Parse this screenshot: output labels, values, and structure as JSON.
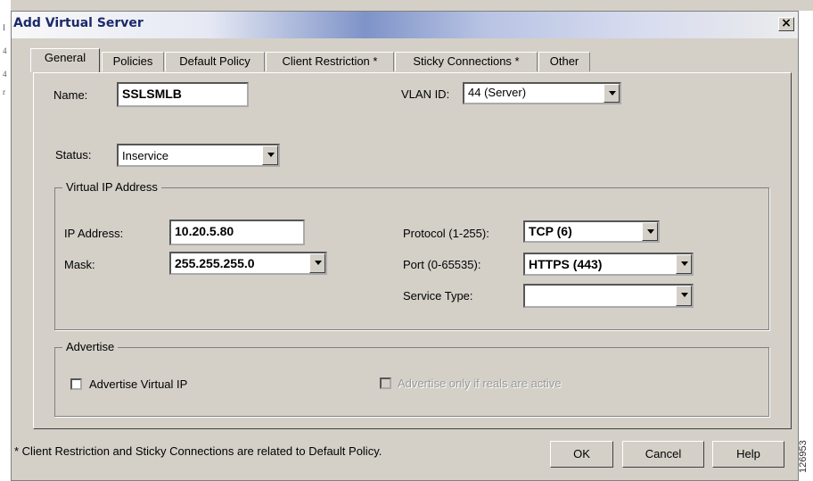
{
  "window": {
    "title": "Add Virtual Server",
    "close_glyph": "×"
  },
  "tabs": [
    {
      "label": "General",
      "active": true
    },
    {
      "label": "Policies"
    },
    {
      "label": "Default Policy"
    },
    {
      "label": "Client Restriction *"
    },
    {
      "label": "Sticky Connections *"
    },
    {
      "label": "Other"
    }
  ],
  "general": {
    "name_label": "Name:",
    "name_value": "SSLSMLB",
    "vlan_label": "VLAN ID:",
    "vlan_value": "44 (Server)",
    "status_label": "Status:",
    "status_value": "Inservice"
  },
  "vip_group": {
    "title": "Virtual IP Address",
    "ip_label": "IP Address:",
    "ip_value": "10.20.5.80",
    "mask_label": "Mask:",
    "mask_value": "255.255.255.0",
    "protocol_label": "Protocol (1-255):",
    "protocol_value": "TCP (6)",
    "port_label": "Port (0-65535):",
    "port_value": "HTTPS (443)",
    "service_type_label": "Service Type:",
    "service_type_value": ""
  },
  "advertise_group": {
    "title": "Advertise",
    "advertise_vip_label": "Advertise Virtual IP",
    "advertise_vip_checked": false,
    "advertise_active_label": "Advertise only if reals are active",
    "advertise_active_checked": false,
    "advertise_active_enabled": false
  },
  "footer": {
    "note": "* Client Restriction and Sticky Connections are related to Default Policy.",
    "ok": "OK",
    "cancel": "Cancel",
    "help": "Help"
  },
  "figure_id": "126953",
  "side_marks": [
    "I",
    "4",
    "4",
    "r"
  ]
}
